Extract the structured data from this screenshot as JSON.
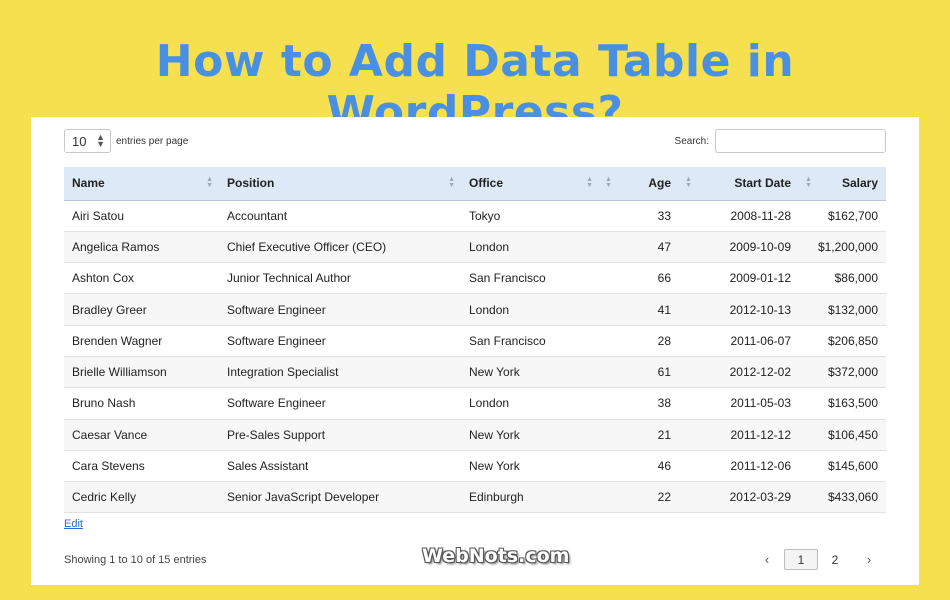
{
  "banner": {
    "title": "How to Add Data Table in WordPress?"
  },
  "controls": {
    "per_page_value": "10",
    "per_page_label": "entries per page",
    "search_label": "Search:",
    "search_value": ""
  },
  "table": {
    "columns": [
      "Name",
      "Position",
      "Office",
      "Age",
      "Start Date",
      "Salary"
    ],
    "rows": [
      [
        "Airi Satou",
        "Accountant",
        "Tokyo",
        "33",
        "2008-11-28",
        "$162,700"
      ],
      [
        "Angelica Ramos",
        "Chief Executive Officer (CEO)",
        "London",
        "47",
        "2009-10-09",
        "$1,200,000"
      ],
      [
        "Ashton Cox",
        "Junior Technical Author",
        "San Francisco",
        "66",
        "2009-01-12",
        "$86,000"
      ],
      [
        "Bradley Greer",
        "Software Engineer",
        "London",
        "41",
        "2012-10-13",
        "$132,000"
      ],
      [
        "Brenden Wagner",
        "Software Engineer",
        "San Francisco",
        "28",
        "2011-06-07",
        "$206,850"
      ],
      [
        "Brielle Williamson",
        "Integration Specialist",
        "New York",
        "61",
        "2012-12-02",
        "$372,000"
      ],
      [
        "Bruno Nash",
        "Software Engineer",
        "London",
        "38",
        "2011-05-03",
        "$163,500"
      ],
      [
        "Caesar Vance",
        "Pre-Sales Support",
        "New York",
        "21",
        "2011-12-12",
        "$106,450"
      ],
      [
        "Cara Stevens",
        "Sales Assistant",
        "New York",
        "46",
        "2011-12-06",
        "$145,600"
      ],
      [
        "Cedric Kelly",
        "Senior JavaScript Developer",
        "Edinburgh",
        "22",
        "2012-03-29",
        "$433,060"
      ]
    ]
  },
  "footer": {
    "edit_label": "Edit",
    "info": "Showing 1 to 10 of 15 entries",
    "watermark": "WebNots.com",
    "pagination": {
      "prev": "‹",
      "pages": [
        "1",
        "2"
      ],
      "active": "1",
      "next": "›"
    }
  },
  "colors": {
    "background": "#f6e04f",
    "title": "#4a90e2",
    "header_row": "#dde9f6"
  }
}
